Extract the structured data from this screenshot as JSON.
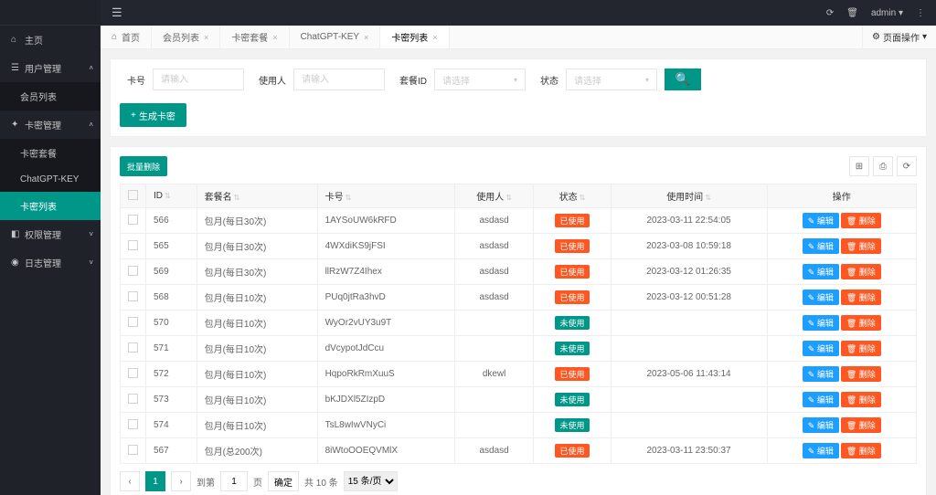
{
  "header": {
    "user": "admin"
  },
  "sidebar": {
    "home": "主页",
    "userMgmt": "用户管理",
    "userSub": {
      "list": "会员列表"
    },
    "cardMgmt": "卡密管理",
    "cardSub": {
      "pkg": "卡密套餐",
      "key": "ChatGPT-KEY",
      "list": "卡密列表"
    },
    "permMgmt": "权限管理",
    "logMgmt": "日志管理"
  },
  "tabs": {
    "home": "首页",
    "t1": "会员列表",
    "t2": "卡密套餐",
    "t3": "ChatGPT-KEY",
    "t4": "卡密列表",
    "ops": "页面操作"
  },
  "filters": {
    "cardNo": {
      "label": "卡号",
      "placeholder": "请输入"
    },
    "userBy": {
      "label": "使用人",
      "placeholder": "请输入"
    },
    "pkgId": {
      "label": "套餐ID",
      "placeholder": "请选择"
    },
    "status": {
      "label": "状态",
      "placeholder": "请选择"
    },
    "genBtn": "生成卡密"
  },
  "toolbar": {
    "batchDel": "批量删除"
  },
  "columns": {
    "id": "ID",
    "pkg": "套餐名",
    "card": "卡号",
    "user": "使用人",
    "status": "状态",
    "time": "使用时间",
    "ops": "操作"
  },
  "statusLabels": {
    "used": "已使用",
    "unused": "未使用"
  },
  "rowBtns": {
    "edit": "编辑",
    "del": "删除"
  },
  "rows": [
    {
      "id": "566",
      "pkg": "包月(每日30次)",
      "card": "1AYSoUW6kRFD",
      "user": "asdasd",
      "status": "used",
      "time": "2023-03-11 22:54:05"
    },
    {
      "id": "565",
      "pkg": "包月(每日30次)",
      "card": "4WXdiKS9jFSI",
      "user": "asdasd",
      "status": "used",
      "time": "2023-03-08 10:59:18"
    },
    {
      "id": "569",
      "pkg": "包月(每日30次)",
      "card": "llRzW7Z4Ihex",
      "user": "asdasd",
      "status": "used",
      "time": "2023-03-12 01:26:35"
    },
    {
      "id": "568",
      "pkg": "包月(每日10次)",
      "card": "PUq0jtRa3hvD",
      "user": "asdasd",
      "status": "used",
      "time": "2023-03-12 00:51:28"
    },
    {
      "id": "570",
      "pkg": "包月(每日10次)",
      "card": "WyOr2vUY3u9T",
      "user": "",
      "status": "unused",
      "time": ""
    },
    {
      "id": "571",
      "pkg": "包月(每日10次)",
      "card": "dVcypotJdCcu",
      "user": "",
      "status": "unused",
      "time": ""
    },
    {
      "id": "572",
      "pkg": "包月(每日10次)",
      "card": "HqpoRkRmXuuS",
      "user": "dkewl",
      "status": "used",
      "time": "2023-05-06 11:43:14"
    },
    {
      "id": "573",
      "pkg": "包月(每日10次)",
      "card": "bKJDXl5ZIzpD",
      "user": "",
      "status": "unused",
      "time": ""
    },
    {
      "id": "574",
      "pkg": "包月(每日10次)",
      "card": "TsL8wIwVNyCi",
      "user": "",
      "status": "unused",
      "time": ""
    },
    {
      "id": "567",
      "pkg": "包月(总200次)",
      "card": "8iWtoOOEQVMlX",
      "user": "asdasd",
      "status": "used",
      "time": "2023-03-11 23:50:37"
    }
  ],
  "pager": {
    "toPage": "到第",
    "pageUnit": "页",
    "confirm": "确定",
    "total": "共 10 条",
    "pageSize": "15 条/页",
    "current": "1"
  }
}
